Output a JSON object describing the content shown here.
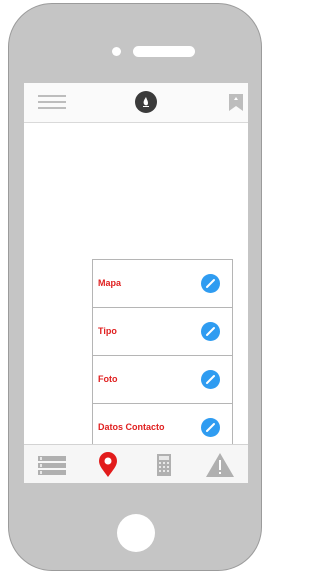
{
  "app": {
    "menu_items": [
      {
        "label": "Mapa",
        "icon": "pencil-icon"
      },
      {
        "label": "Tipo",
        "icon": "pencil-icon"
      },
      {
        "label": "Foto",
        "icon": "pencil-icon"
      },
      {
        "label": "Datos Contacto",
        "icon": "pencil-icon"
      }
    ],
    "tabs": [
      {
        "icon": "list-icon",
        "active": false
      },
      {
        "icon": "map-pin-icon",
        "active": true
      },
      {
        "icon": "calculator-icon",
        "active": false
      },
      {
        "icon": "warning-icon",
        "active": false
      }
    ]
  },
  "colors": {
    "accent_red": "#e02020",
    "edit_blue": "#2f9cf1",
    "phone_body": "#c5c5c5"
  }
}
